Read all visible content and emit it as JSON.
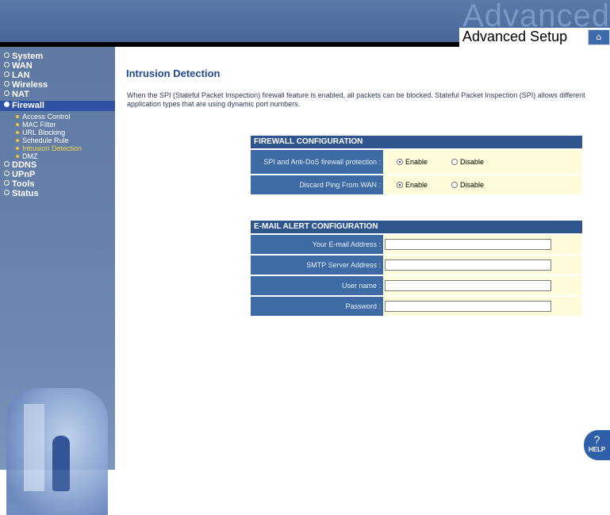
{
  "header": {
    "watermark": "Advanced",
    "title": "Advanced Setup",
    "home_icon": "home-icon"
  },
  "sidebar": {
    "items": [
      {
        "label": "System"
      },
      {
        "label": "WAN"
      },
      {
        "label": "LAN"
      },
      {
        "label": "Wireless"
      },
      {
        "label": "NAT"
      },
      {
        "label": "Firewall",
        "active": true
      },
      {
        "label": "DDNS"
      },
      {
        "label": "UPnP"
      },
      {
        "label": "Tools"
      },
      {
        "label": "Status"
      }
    ],
    "subitems": [
      {
        "label": "Access Control"
      },
      {
        "label": "MAC Filter"
      },
      {
        "label": "URL Blocking"
      },
      {
        "label": "Schedule Rule"
      },
      {
        "label": "Intrusion Detection",
        "current": true
      },
      {
        "label": "DMZ"
      }
    ]
  },
  "main": {
    "title": "Intrusion Detection",
    "description": "When the SPI (Stateful Packet Inspection) firewall feature is enabled, all packets can be blocked.  Stateful Packet Inspection (SPI) allows different application types that are using dynamic port numbers."
  },
  "firewall": {
    "heading": "FIREWALL CONFIGURATION",
    "rows": [
      {
        "label": "SPI and Anti-DoS firewall protection :",
        "enable": "Enable",
        "disable": "Disable",
        "selected": "Enable"
      },
      {
        "label": "Discard Ping From WAN :",
        "enable": "Enable",
        "disable": "Disable",
        "selected": "Enable"
      }
    ]
  },
  "email": {
    "heading": "E-MAIL ALERT CONFIGURATION",
    "fields": [
      {
        "label": "Your E-mail Address :",
        "value": ""
      },
      {
        "label": "SMTP Server Address :",
        "value": ""
      },
      {
        "label": "User name :",
        "value": ""
      },
      {
        "label": "Password :",
        "value": ""
      }
    ]
  },
  "help": {
    "icon": "question-icon",
    "label": "HELP"
  },
  "colors": {
    "header_blue": "#4d6d9e",
    "sidebar_blue": "#6480ab",
    "panel_head": "#2f558f",
    "label_cell": "#3e6ba5",
    "value_cell": "#fdfbd9",
    "title_text": "#1f4a8f",
    "submenu_current": "#f0d84a"
  }
}
